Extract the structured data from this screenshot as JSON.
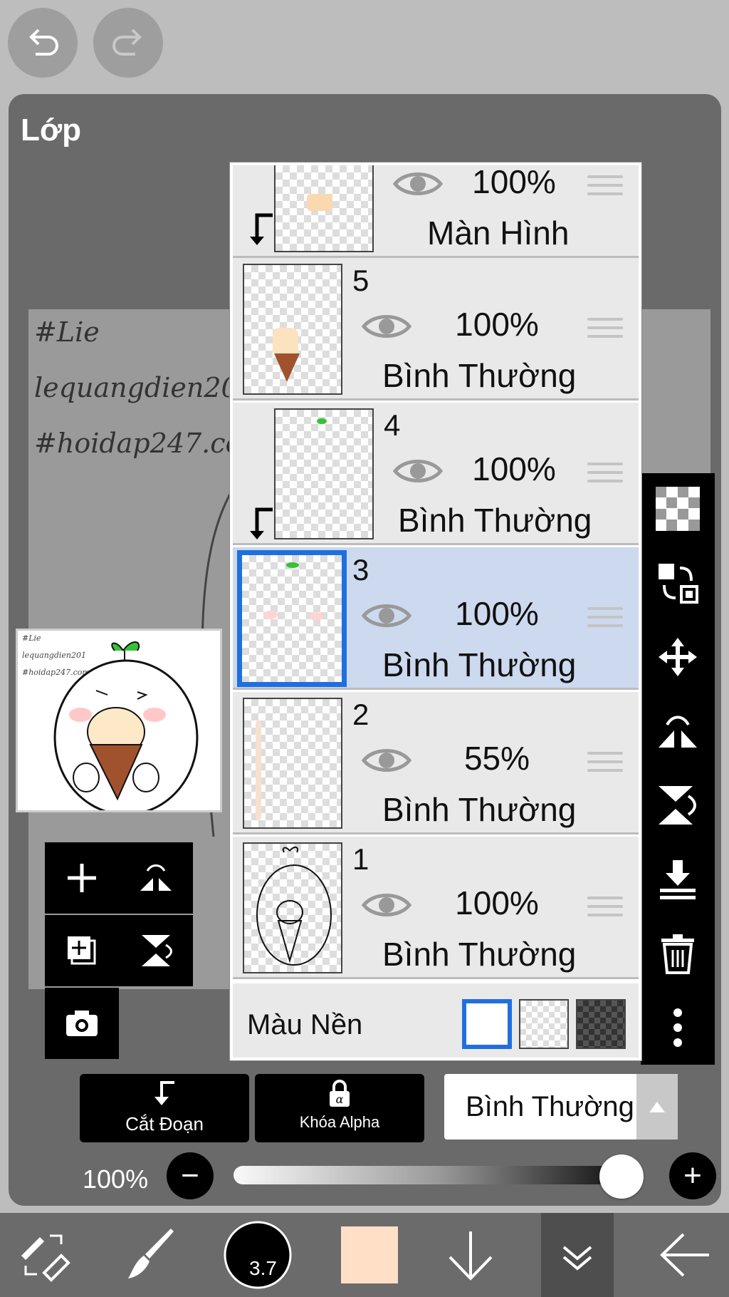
{
  "panel": {
    "title": "Lớp"
  },
  "canvas": {
    "watermark_lines": [
      "#Lie",
      "lequangdien201",
      "#hoidap247.com"
    ],
    "thumb_watermark_lines": [
      "#Lie",
      "lequangdien201",
      "#hoidap247.com"
    ]
  },
  "layers": [
    {
      "number": "",
      "opacity": "100%",
      "blend": "Màn Hình",
      "clipped": true,
      "selected": false
    },
    {
      "number": "5",
      "opacity": "100%",
      "blend": "Bình Thường",
      "clipped": false,
      "selected": false
    },
    {
      "number": "4",
      "opacity": "100%",
      "blend": "Bình Thường",
      "clipped": true,
      "selected": false
    },
    {
      "number": "3",
      "opacity": "100%",
      "blend": "Bình Thường",
      "clipped": false,
      "selected": true
    },
    {
      "number": "2",
      "opacity": "55%",
      "blend": "Bình Thường",
      "clipped": false,
      "selected": false
    },
    {
      "number": "1",
      "opacity": "100%",
      "blend": "Bình Thường",
      "clipped": false,
      "selected": false
    }
  ],
  "background_row": {
    "label": "Màu Nền"
  },
  "buttons": {
    "clipping_label": "Cắt Đoạn",
    "alpha_lock_label": "Khóa Alpha",
    "blend_mode_value": "Bình Thường"
  },
  "opacity_slider": {
    "label": "100%",
    "value": 1.0
  },
  "toolbar": {
    "brush_size": "3.7",
    "current_color": "#ffdfc6"
  },
  "colors": {
    "selection_blue": "#1f6fe0",
    "selected_row": "#ccd9ee"
  }
}
